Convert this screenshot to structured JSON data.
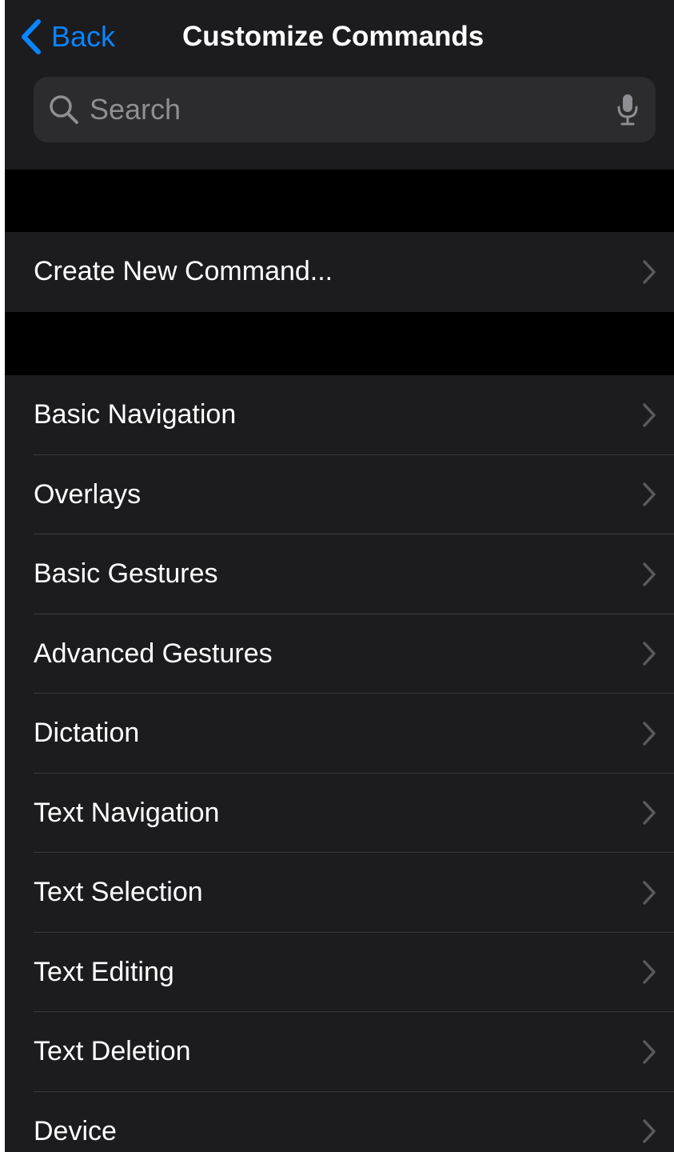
{
  "nav": {
    "back_label": "Back",
    "title": "Customize Commands"
  },
  "search": {
    "placeholder": "Search",
    "value": ""
  },
  "create_section": {
    "label": "Create New Command..."
  },
  "categories": [
    {
      "label": "Basic Navigation"
    },
    {
      "label": "Overlays"
    },
    {
      "label": "Basic Gestures"
    },
    {
      "label": "Advanced Gestures"
    },
    {
      "label": "Dictation"
    },
    {
      "label": "Text Navigation"
    },
    {
      "label": "Text Selection"
    },
    {
      "label": "Text Editing"
    },
    {
      "label": "Text Deletion"
    },
    {
      "label": "Device"
    }
  ],
  "icons": {
    "back": "chevron-left-icon",
    "search": "magnifying-glass-icon",
    "mic": "microphone-icon",
    "row": "chevron-right-icon"
  },
  "colors": {
    "accent": "#0a84ff",
    "background": "#000000",
    "cell": "#1c1c1e",
    "search_field": "#2c2c2e",
    "separator": "#38383a",
    "secondary_text": "#8e8e93"
  }
}
